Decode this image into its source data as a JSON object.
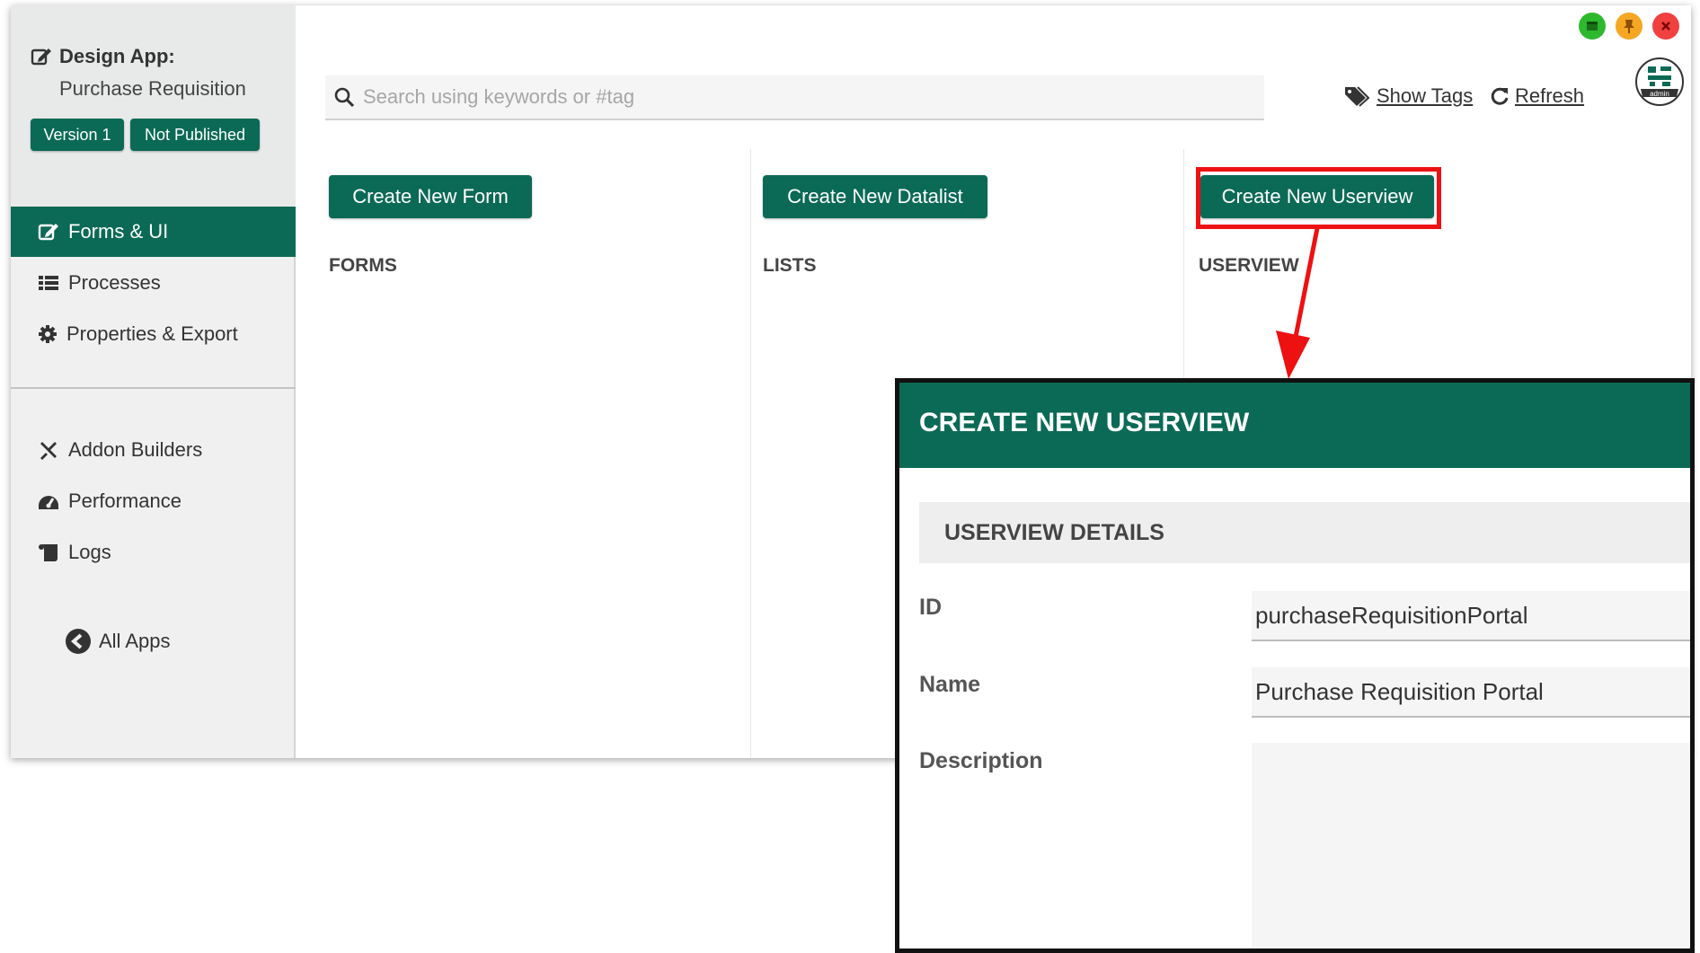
{
  "colors": {
    "brand_green": "#0b6a55",
    "highlight_red": "#ee1111",
    "window_green": "#2eb82e",
    "window_orange": "#f5a623",
    "window_red": "#f04040"
  },
  "app_header": {
    "title": "Design App:",
    "app_name": "Purchase Requisition",
    "version_badge": "Version 1",
    "status_badge": "Not Published"
  },
  "sidebar": {
    "items": [
      {
        "label": "Forms & UI",
        "icon": "edit-icon",
        "active": true
      },
      {
        "label": "Processes",
        "icon": "list-icon",
        "active": false
      },
      {
        "label": "Properties & Export",
        "icon": "gear-icon",
        "active": false
      }
    ],
    "tools": [
      {
        "label": "Addon Builders",
        "icon": "tools-icon"
      },
      {
        "label": "Performance",
        "icon": "gauge-icon"
      },
      {
        "label": "Logs",
        "icon": "scroll-icon"
      }
    ],
    "all_apps": "All Apps"
  },
  "toolbar": {
    "search_placeholder": "Search using keywords or #tag",
    "show_tags": "Show Tags",
    "refresh": "Refresh",
    "avatar_label": "admin"
  },
  "columns": [
    {
      "button": "Create New Form",
      "heading": "FORMS"
    },
    {
      "button": "Create New Datalist",
      "heading": "LISTS"
    },
    {
      "button": "Create New Userview",
      "heading": "USERVIEW"
    }
  ],
  "modal": {
    "title": "CREATE NEW USERVIEW",
    "section": "USERVIEW DETAILS",
    "fields": {
      "id_label": "ID",
      "id_value": "purchaseRequisitionPortal",
      "name_label": "Name",
      "name_value": "Purchase Requisition Portal",
      "description_label": "Description",
      "description_value": ""
    }
  }
}
